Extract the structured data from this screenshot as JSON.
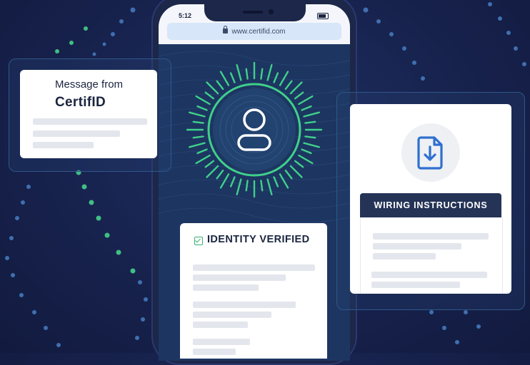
{
  "phone": {
    "time": "5:12",
    "url": "www.certifid.com"
  },
  "message_card": {
    "line1": "Message from",
    "brand": "CertifID"
  },
  "identity_card": {
    "title": "IDENTITY VERIFIED"
  },
  "wiring_card": {
    "header": "WIRING INSTRUCTIONS"
  },
  "colors": {
    "background": "#17224d",
    "accent_green": "#3fd08a",
    "header_dark": "#243356",
    "document_blue": "#2f6fcf"
  },
  "icons": [
    "lock-icon",
    "user-icon",
    "check-icon",
    "document-download-icon",
    "battery-icon"
  ]
}
